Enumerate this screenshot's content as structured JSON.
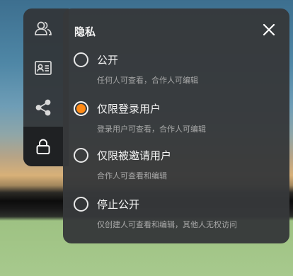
{
  "sidebar": {
    "items": [
      {
        "icon": "members-icon"
      },
      {
        "icon": "id-card-icon"
      },
      {
        "icon": "share-icon"
      },
      {
        "icon": "lock-icon",
        "active": true
      }
    ]
  },
  "privacy_panel": {
    "title": "隐私",
    "close_icon": "close-icon",
    "options": [
      {
        "label": "公开",
        "description": "任何人可查看，合作人可编辑",
        "selected": false
      },
      {
        "label": "仅限登录用户",
        "description": "登录用户可查看，合作人可编辑",
        "selected": true
      },
      {
        "label": "仅限被邀请用户",
        "description": "合作人可查看和编辑",
        "selected": false
      },
      {
        "label": "停止公开",
        "description": "仅创建人可查看和编辑，其他人无权访问",
        "selected": false
      }
    ]
  },
  "colors": {
    "accent": "#ff8a16",
    "panel_bg": "#36383a",
    "secondary_text": "#a9a9a9"
  }
}
